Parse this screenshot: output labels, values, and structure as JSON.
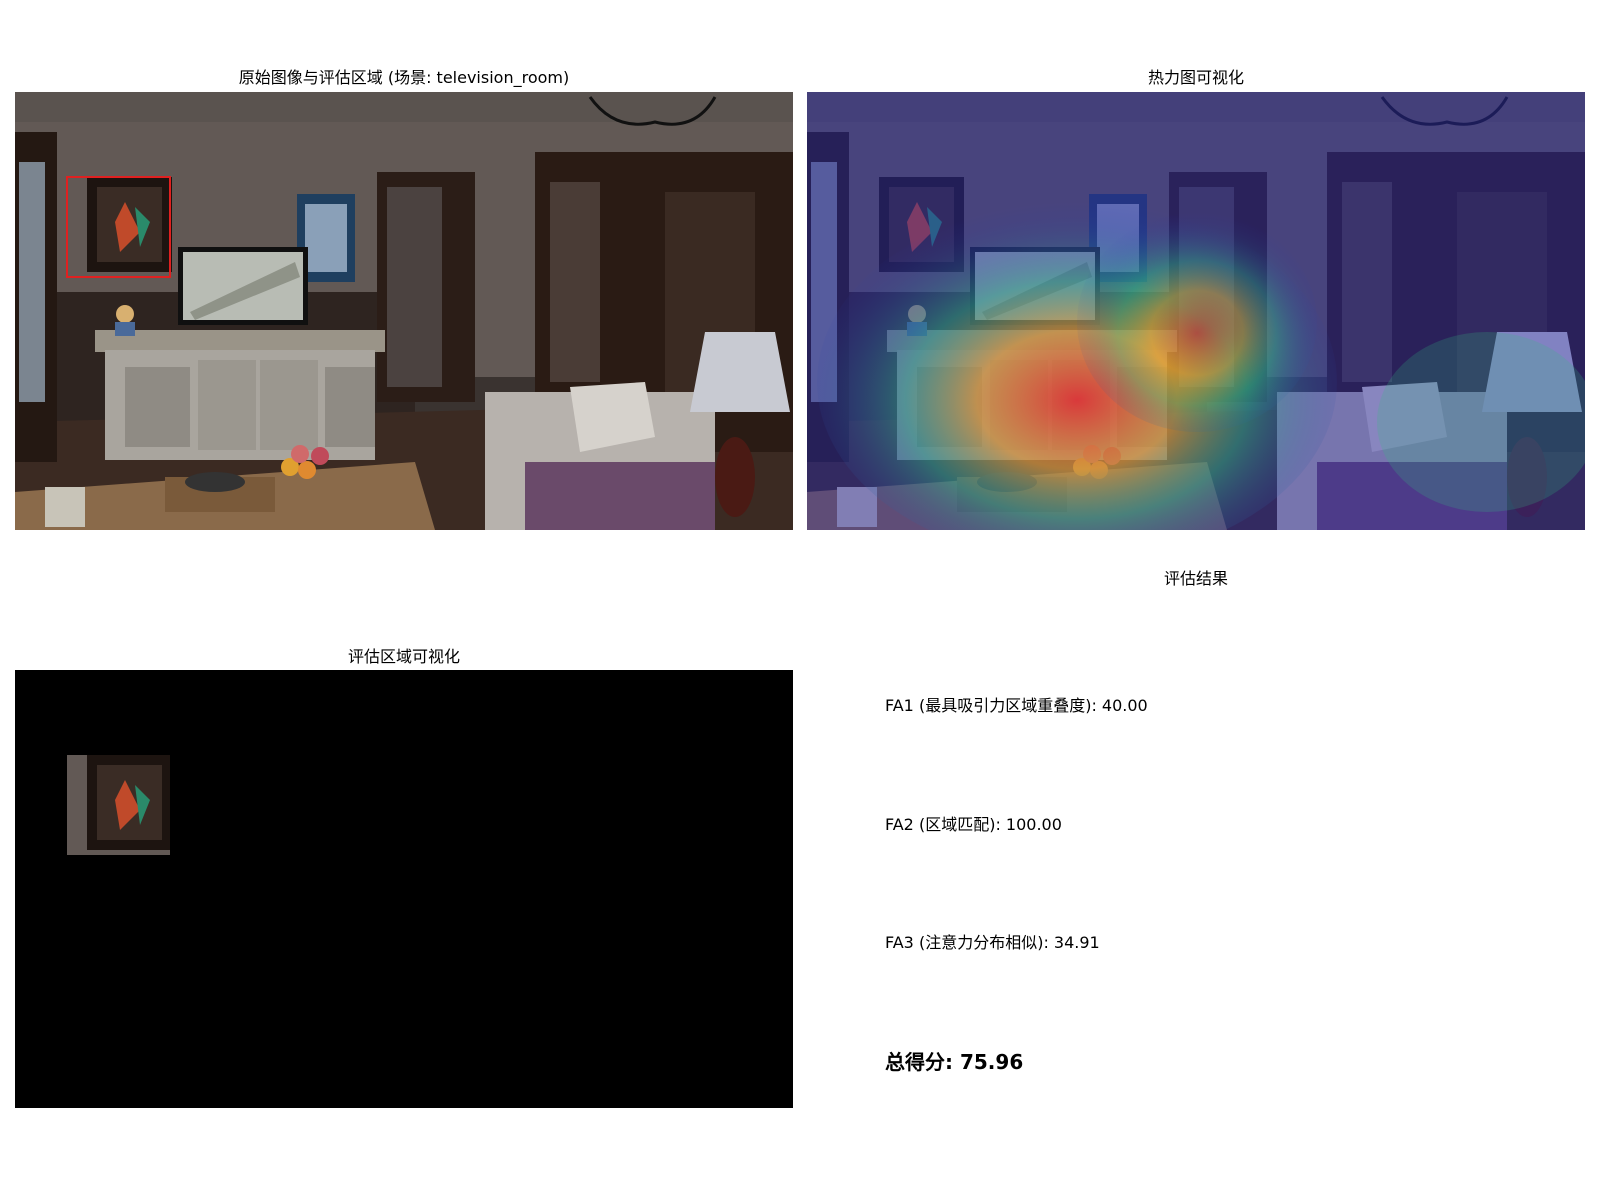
{
  "panels": {
    "original": {
      "title": "原始图像与评估区域 (场景: television_room)"
    },
    "heatmap": {
      "title": "热力图可视化"
    },
    "region": {
      "title": "评估区域可视化"
    },
    "results": {
      "title": "评估结果"
    }
  },
  "metrics": [
    {
      "label": "FA1 (最具吸引力区域重叠度)",
      "value": "40.00"
    },
    {
      "label": "FA2 (区域匹配)",
      "value": "100.00"
    },
    {
      "label": "FA3 (注意力分布相似)",
      "value": "34.91"
    }
  ],
  "total": {
    "label": "总得分",
    "value": "75.96"
  },
  "colors": {
    "box": "#e02020",
    "heat_hot": "#ff2a1a",
    "heat_cool": "#2a2ab0"
  },
  "icons": [
    "scene-photo",
    "attention-heatmap-overlay",
    "region-mask"
  ]
}
